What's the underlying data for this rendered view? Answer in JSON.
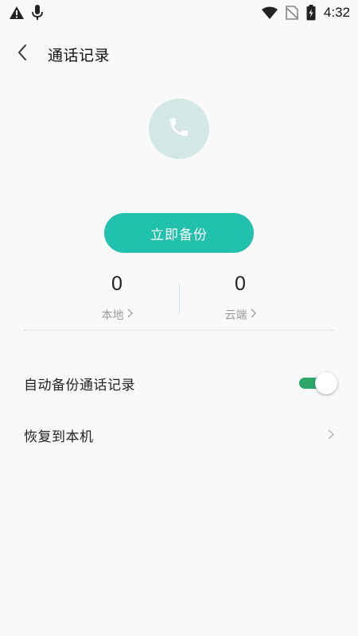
{
  "status_bar": {
    "time": "4:32",
    "left_icons": [
      "warning-icon",
      "microphone-icon"
    ],
    "right_icons": [
      "wifi-icon",
      "no-sim-icon",
      "battery-charging-icon"
    ]
  },
  "header": {
    "title": "通话记录",
    "back_icon": "chevron-left-icon"
  },
  "hero": {
    "icon": "phone-icon",
    "circle_color": "#d3e7e4"
  },
  "backup_button": {
    "label": "立即备份",
    "color": "#22c1ad"
  },
  "stats": {
    "local": {
      "value": "0",
      "label": "本地"
    },
    "cloud": {
      "value": "0",
      "label": "云端"
    }
  },
  "settings": {
    "auto_backup": {
      "label": "自动备份通话记录",
      "enabled": true,
      "toggle_color": "#2ea86a"
    },
    "restore": {
      "label": "恢复到本机"
    }
  }
}
